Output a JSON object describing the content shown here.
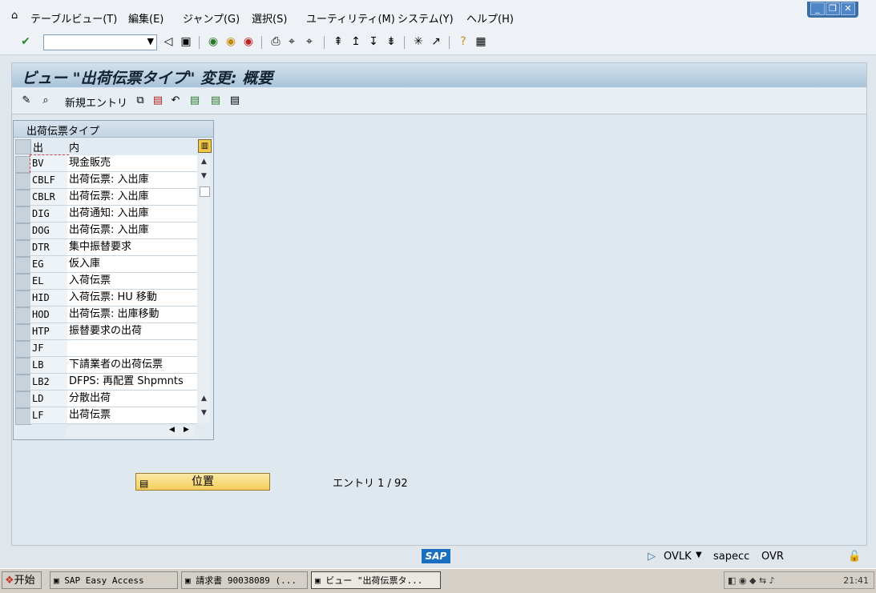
{
  "menu": {
    "items": [
      "テーブルビュー(T)",
      "編集(E)",
      "ジャンプ(G)",
      "選択(S)",
      "ユーティリティ(M)",
      "システム(Y)",
      "ヘルプ(H)"
    ]
  },
  "toolbar": {
    "command_field": ""
  },
  "screen": {
    "title": "ビュー \"出荷伝票タイプ\" 変更: 概要",
    "new_entries_label": "新規エントリ"
  },
  "table": {
    "title": "出荷伝票タイプ",
    "col_code": "出荷T",
    "col_desc": "内容説明",
    "rows": [
      {
        "code": "BV",
        "desc": "現金販売"
      },
      {
        "code": "CBLF",
        "desc": "出荷伝票: 入出庫"
      },
      {
        "code": "CBLR",
        "desc": "出荷伝票: 入出庫"
      },
      {
        "code": "DIG",
        "desc": "出荷通知: 入出庫"
      },
      {
        "code": "DOG",
        "desc": "出荷伝票: 入出庫"
      },
      {
        "code": "DTR",
        "desc": "集中振替要求"
      },
      {
        "code": "EG",
        "desc": "仮入庫"
      },
      {
        "code": "EL",
        "desc": "入荷伝票"
      },
      {
        "code": "HID",
        "desc": "入荷伝票: HU 移動"
      },
      {
        "code": "HOD",
        "desc": "出荷伝票: 出庫移動"
      },
      {
        "code": "HTP",
        "desc": "振替要求の出荷"
      },
      {
        "code": "JF",
        "desc": ""
      },
      {
        "code": "LB",
        "desc": "下請業者の出荷伝票"
      },
      {
        "code": "LB2",
        "desc": "DFPS: 再配置 Shpmnts"
      },
      {
        "code": "LD",
        "desc": "分散出荷"
      },
      {
        "code": "LF",
        "desc": "出荷伝票"
      }
    ]
  },
  "position_button": "位置",
  "entry_info": "エントリ 1 / 92",
  "status": {
    "sap_logo": "SAP",
    "transaction": "OVLK",
    "server": "sapecc",
    "mode": "OVR"
  },
  "taskbar": {
    "start": "开始",
    "tasks": [
      "SAP Easy Access",
      "請求書 90038089   (...",
      "ビュー \"出荷伝票タ..."
    ],
    "clock": "21:41"
  }
}
